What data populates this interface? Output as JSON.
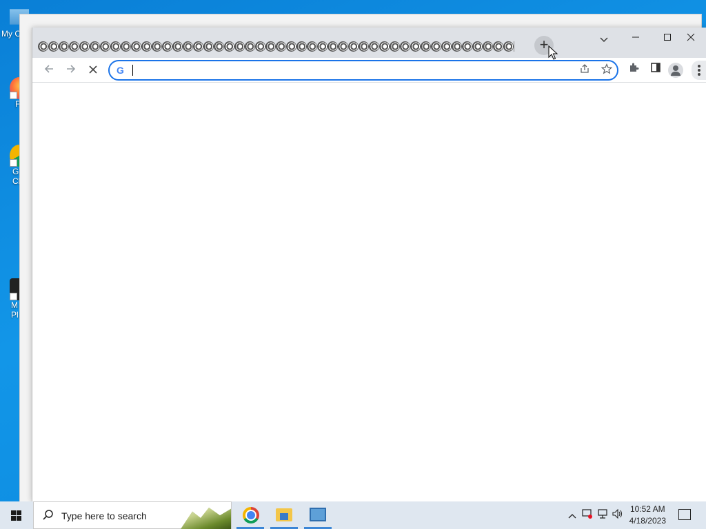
{
  "desktop": {
    "icons": [
      {
        "label": "My C",
        "icon": "computer-icon"
      },
      {
        "label": "F",
        "icon": "firefox-icon"
      },
      {
        "label": "G\nCh",
        "icon": "chrome-shortcut-icon"
      },
      {
        "label": "M\nPl",
        "icon": "media-player-icon"
      }
    ]
  },
  "browser": {
    "tab_count": 46,
    "tab_favicon": "loading-globe-icon",
    "new_tab_label": "+",
    "tab_search_icon": "chevron-down-icon",
    "window_controls": {
      "minimize": "—",
      "maximize": "☐",
      "close": "✕"
    },
    "nav": {
      "back": "←",
      "forward": "→",
      "stop": "✕"
    },
    "omnibox": {
      "value": "",
      "placeholder": "",
      "provider_icon": "G"
    },
    "omnibox_actions": [
      "share-icon",
      "bookmark-star-icon"
    ],
    "toolbar_icons": [
      "extensions-icon",
      "side-panel-icon",
      "profile-icon",
      "menu-icon"
    ]
  },
  "taskbar": {
    "search_placeholder": "Type here to search",
    "apps": [
      "chrome-icon",
      "file-explorer-icon",
      "control-panel-icon"
    ],
    "tray_icons": [
      "chevron-up-icon",
      "security-icon",
      "network-icon",
      "volume-icon"
    ],
    "clock_time": "10:52 AM",
    "clock_date": "4/18/2023"
  },
  "colors": {
    "desktop_bg": "#0a7fd6",
    "tabstrip_bg": "#dee1e6",
    "omnibox_focus": "#1a73e8",
    "taskbar_bg": "#dfe7f0"
  }
}
